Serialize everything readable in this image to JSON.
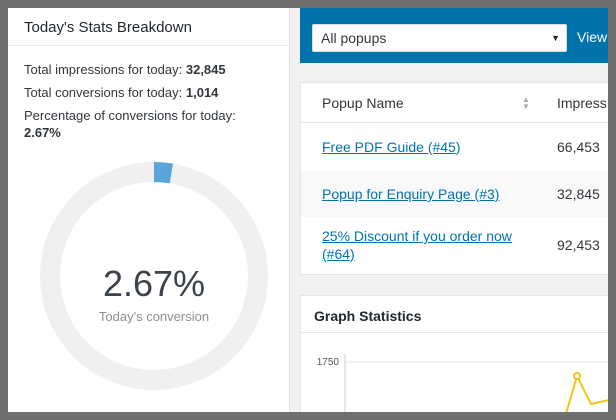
{
  "stats": {
    "title": "Today's Stats Breakdown",
    "impressions_label": "Total impressions for today:",
    "impressions_value": "32,845",
    "conversions_label": "Total conversions for today:",
    "conversions_value": "1,014",
    "percentage_label": "Percentage of conversions for today:",
    "percentage_value": "2.67%",
    "donut": {
      "value_text": "2.67%",
      "caption": "Today's conversion",
      "fraction": 0.0267,
      "track_color": "#f0f0f0",
      "fill_color": "#5aa5d8"
    }
  },
  "filter": {
    "selected": "All popups",
    "view_label": "View",
    "bar_color": "#0073aa"
  },
  "table": {
    "columns": [
      "Popup Name",
      "Impress"
    ],
    "rows": [
      {
        "name": "Free PDF Guide (#45)",
        "impressions": "66,453"
      },
      {
        "name": "Popup for Enquiry Page (#3)",
        "impressions": "32,845"
      },
      {
        "name": "25% Discount if you order now (#64)",
        "impressions": "92,453"
      }
    ]
  },
  "graph": {
    "title": "Graph Statistics",
    "chart_data": {
      "type": "line",
      "y_tick_labels": [
        "1750"
      ],
      "line_color": "#f0c419"
    }
  }
}
